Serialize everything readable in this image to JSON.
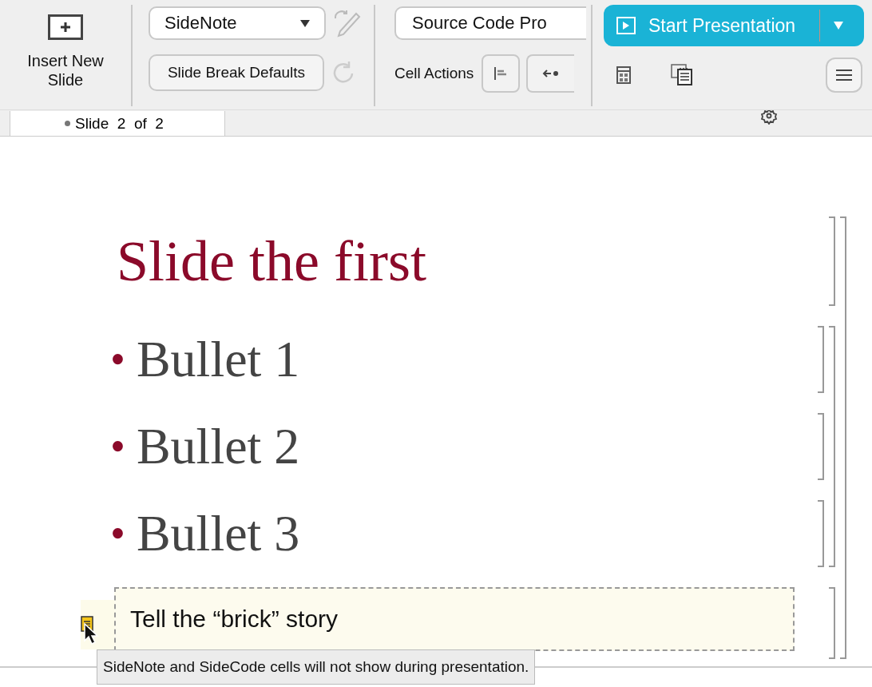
{
  "toolbar": {
    "insert_button": {
      "label": "Insert New Slide"
    },
    "cell_style_dropdown": {
      "value": "SideNote"
    },
    "slide_break_button": {
      "label": "Slide Break Defaults"
    },
    "font_field": {
      "value": "Source Code Pro"
    },
    "cell_actions_label": "Cell Actions",
    "start_button": {
      "label": "Start Presentation"
    }
  },
  "tab": {
    "label": "Slide  2  of  2"
  },
  "slide": {
    "title": "Slide the first",
    "bullets": [
      {
        "marker": "•",
        "text": "Bullet 1"
      },
      {
        "marker": "•",
        "text": "Bullet 2"
      },
      {
        "marker": "•",
        "text": "Bullet 3"
      }
    ],
    "sidenote": "Tell the “brick” story"
  },
  "tooltip": "SideNote and SideCode cells will not show during presentation."
}
